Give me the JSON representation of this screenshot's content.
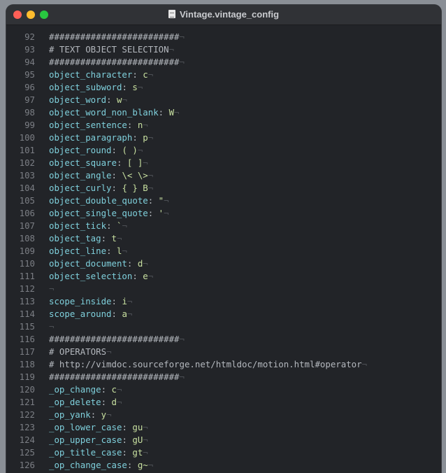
{
  "window": {
    "title": "Vintage.vintage_config",
    "colors": {
      "background": "#222428",
      "key": "#7fd0dc",
      "value": "#c8e0a0",
      "comment": "#b4b8be",
      "line_number": "#7b7e84"
    }
  },
  "editor": {
    "line_end_marker": "¬",
    "lines": [
      {
        "n": "92",
        "type": "comment",
        "text": "#########################"
      },
      {
        "n": "93",
        "type": "comment",
        "text": "# TEXT OBJECT SELECTION"
      },
      {
        "n": "94",
        "type": "comment",
        "text": "#########################"
      },
      {
        "n": "95",
        "type": "kv",
        "key": "object_character",
        "value": "c"
      },
      {
        "n": "96",
        "type": "kv",
        "key": "object_subword",
        "value": "s"
      },
      {
        "n": "97",
        "type": "kv",
        "key": "object_word",
        "value": "w"
      },
      {
        "n": "98",
        "type": "kv",
        "key": "object_word_non_blank",
        "value": "W"
      },
      {
        "n": "99",
        "type": "kv",
        "key": "object_sentence",
        "value": "n"
      },
      {
        "n": "100",
        "type": "kv",
        "key": "object_paragraph",
        "value": "p"
      },
      {
        "n": "101",
        "type": "kv",
        "key": "object_round",
        "value": "( )"
      },
      {
        "n": "102",
        "type": "kv",
        "key": "object_square",
        "value": "[ ]"
      },
      {
        "n": "103",
        "type": "kv",
        "key": "object_angle",
        "value": "\\< \\>"
      },
      {
        "n": "104",
        "type": "kv",
        "key": "object_curly",
        "value": "{ } B"
      },
      {
        "n": "105",
        "type": "kv",
        "key": "object_double_quote",
        "value": "\""
      },
      {
        "n": "106",
        "type": "kv",
        "key": "object_single_quote",
        "value": "'"
      },
      {
        "n": "107",
        "type": "kv",
        "key": "object_tick",
        "value": "`"
      },
      {
        "n": "108",
        "type": "kv",
        "key": "object_tag",
        "value": "t"
      },
      {
        "n": "109",
        "type": "kv",
        "key": "object_line",
        "value": "l"
      },
      {
        "n": "110",
        "type": "kv",
        "key": "object_document",
        "value": "d"
      },
      {
        "n": "111",
        "type": "kv",
        "key": "object_selection",
        "value": "e"
      },
      {
        "n": "112",
        "type": "blank",
        "text": ""
      },
      {
        "n": "113",
        "type": "kv",
        "key": "scope_inside",
        "value": "i"
      },
      {
        "n": "114",
        "type": "kv",
        "key": "scope_around",
        "value": "a"
      },
      {
        "n": "115",
        "type": "blank",
        "text": ""
      },
      {
        "n": "116",
        "type": "comment",
        "text": "#########################"
      },
      {
        "n": "117",
        "type": "comment",
        "text": "# OPERATORS"
      },
      {
        "n": "118",
        "type": "comment",
        "text": "# http://vimdoc.sourceforge.net/htmldoc/motion.html#operator"
      },
      {
        "n": "119",
        "type": "comment",
        "text": "#########################"
      },
      {
        "n": "120",
        "type": "kv",
        "key": "_op_change",
        "value": "c"
      },
      {
        "n": "121",
        "type": "kv",
        "key": "_op_delete",
        "value": "d"
      },
      {
        "n": "122",
        "type": "kv",
        "key": "_op_yank",
        "value": "y"
      },
      {
        "n": "123",
        "type": "kv",
        "key": "_op_lower_case",
        "value": "gu"
      },
      {
        "n": "124",
        "type": "kv",
        "key": "_op_upper_case",
        "value": "gU"
      },
      {
        "n": "125",
        "type": "kv",
        "key": "_op_title_case",
        "value": "gt"
      },
      {
        "n": "126",
        "type": "kv",
        "key": "_op_change_case",
        "value": "g~"
      }
    ]
  }
}
